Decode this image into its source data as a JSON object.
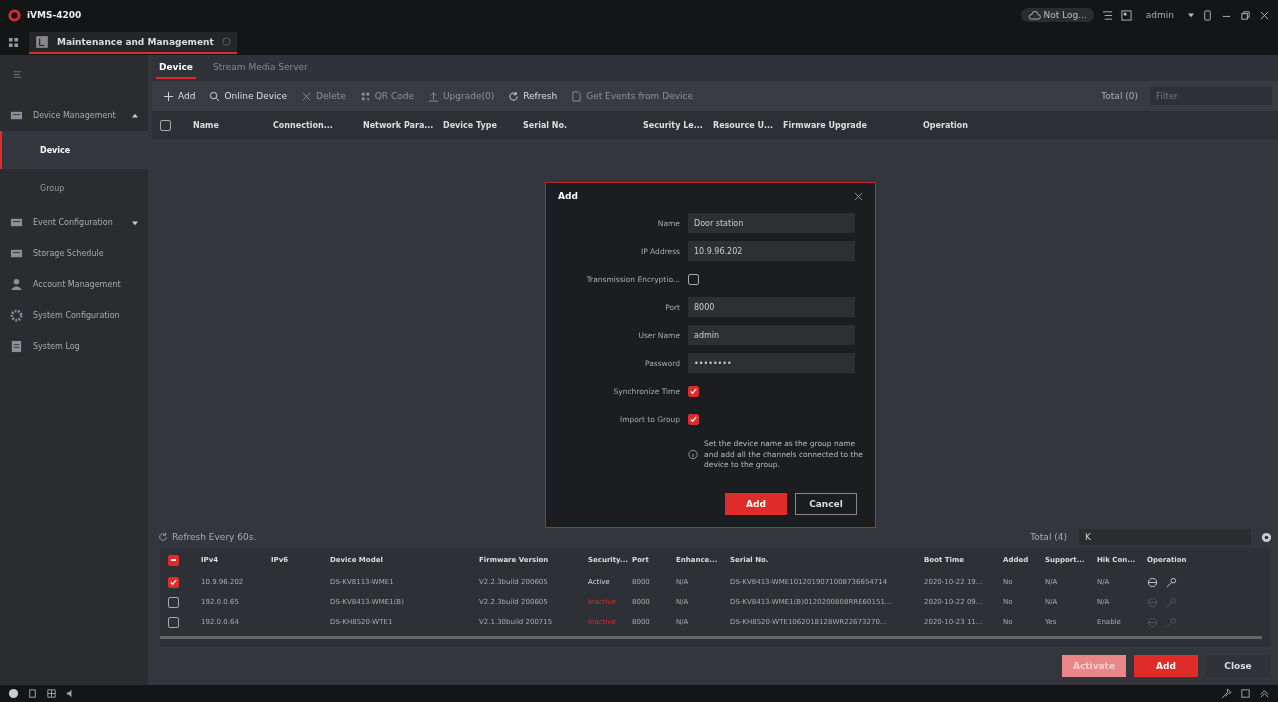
{
  "window": {
    "title": "iVMS-4200",
    "cloud_status": "Not Log...",
    "user": "admin"
  },
  "app_tabs": [
    {
      "label": "Maintenance and Management",
      "selected": true
    }
  ],
  "sidebar": {
    "items": [
      {
        "label": "Device Management",
        "expanded": true,
        "children": [
          {
            "label": "Device",
            "selected": true
          },
          {
            "label": "Group",
            "selected": false
          }
        ]
      },
      {
        "label": "Event Configuration",
        "expanded": false
      },
      {
        "label": "Storage Schedule"
      },
      {
        "label": "Account Management"
      },
      {
        "label": "System Configuration"
      },
      {
        "label": "System Log"
      }
    ]
  },
  "tabs": [
    {
      "label": "Device",
      "selected": true
    },
    {
      "label": "Stream Media Server",
      "selected": false
    }
  ],
  "toolbar": {
    "actions": [
      {
        "label": "Add",
        "disabled": false
      },
      {
        "label": "Online Device",
        "disabled": false
      },
      {
        "label": "Delete",
        "disabled": true
      },
      {
        "label": "QR Code",
        "disabled": true
      },
      {
        "label": "Upgrade(0)",
        "disabled": true
      },
      {
        "label": "Refresh",
        "disabled": false
      },
      {
        "label": "Get Events from Device",
        "disabled": true
      }
    ],
    "total": "Total (0)",
    "filter_placeholder": "Filter"
  },
  "device_table": {
    "select_all": {
      "checked": false
    },
    "columns": [
      "Name",
      "Connection...",
      "Network Para...",
      "Device Type",
      "Serial No.",
      "Security Le...",
      "Resource U...",
      "Firmware Upgrade",
      "Operation"
    ]
  },
  "online": {
    "refresh_label": "Refresh Every 60s.",
    "total": "Total (4)",
    "filter_value": "K",
    "header_checkbox": {
      "indeterminate": true
    },
    "columns": [
      "IPv4",
      "IPv6",
      "Device Model",
      "Firmware Version",
      "Security...",
      "Port",
      "Enhance...",
      "Serial No.",
      "Boot Time",
      "Added",
      "Support...",
      "Hik Con...",
      "Operation"
    ],
    "rows": [
      {
        "checked": true,
        "ipv4": "10.9.96.202",
        "ipv6": "",
        "model": "DS-KV8113-WME1",
        "firmware": "V2.2.3build 200605",
        "security": "Active",
        "active": true,
        "port": "8000",
        "enhance": "N/A",
        "serial": "DS-KV8413-WME1012019071008736654714",
        "boot": "2020-10-22 19...",
        "added": "No",
        "support": "N/A",
        "hik": "N/A",
        "operations_enabled": true
      },
      {
        "checked": false,
        "ipv4": "192.0.0.65",
        "ipv6": "",
        "model": "DS-KV8413-WME1(B)",
        "firmware": "V2.2.3build 200605",
        "security": "Inactive",
        "active": false,
        "port": "8000",
        "enhance": "N/A",
        "serial": "DS-KV8413-WME1(B)0120200808RRE60151...",
        "boot": "2020-10-22 09...",
        "added": "No",
        "support": "N/A",
        "hik": "N/A",
        "operations_enabled": false
      },
      {
        "checked": false,
        "ipv4": "192.0.0.64",
        "ipv6": "",
        "model": "DS-KH8520-WTE1",
        "firmware": "V2.1.30build 200715",
        "security": "Inactive",
        "active": false,
        "port": "8000",
        "enhance": "N/A",
        "serial": "DS-KH8520-WTE1062018128WR22673270...",
        "boot": "2020-10-23 11...",
        "added": "No",
        "support": "Yes",
        "hik": "Enable",
        "operations_enabled": false
      }
    ],
    "buttons": [
      {
        "label": "Activate",
        "kind": "primary",
        "disabled": true
      },
      {
        "label": "Add",
        "kind": "primary",
        "disabled": false
      },
      {
        "label": "Close",
        "kind": "secondary"
      }
    ]
  },
  "dialog": {
    "title": "Add",
    "fields": [
      {
        "kind": "text",
        "label": "Name",
        "value": "Door station"
      },
      {
        "kind": "text",
        "label": "IP Address",
        "value": "10.9.96.202"
      },
      {
        "kind": "checkbox",
        "label": "Transmission Encryptio...",
        "checked": false
      },
      {
        "kind": "text",
        "label": "Port",
        "value": "8000"
      },
      {
        "kind": "text",
        "label": "User Name",
        "value": "admin"
      },
      {
        "kind": "password",
        "label": "Password",
        "value": "••••••••"
      },
      {
        "kind": "checkbox",
        "label": "Synchronize Time",
        "checked": true
      },
      {
        "kind": "checkbox",
        "label": "Import to Group",
        "checked": true
      }
    ],
    "hint": "Set the device name as the group name and add all the channels connected to the device to the group.",
    "buttons": [
      {
        "label": "Add",
        "kind": "primary"
      },
      {
        "label": "Cancel",
        "kind": "secondary"
      }
    ]
  }
}
